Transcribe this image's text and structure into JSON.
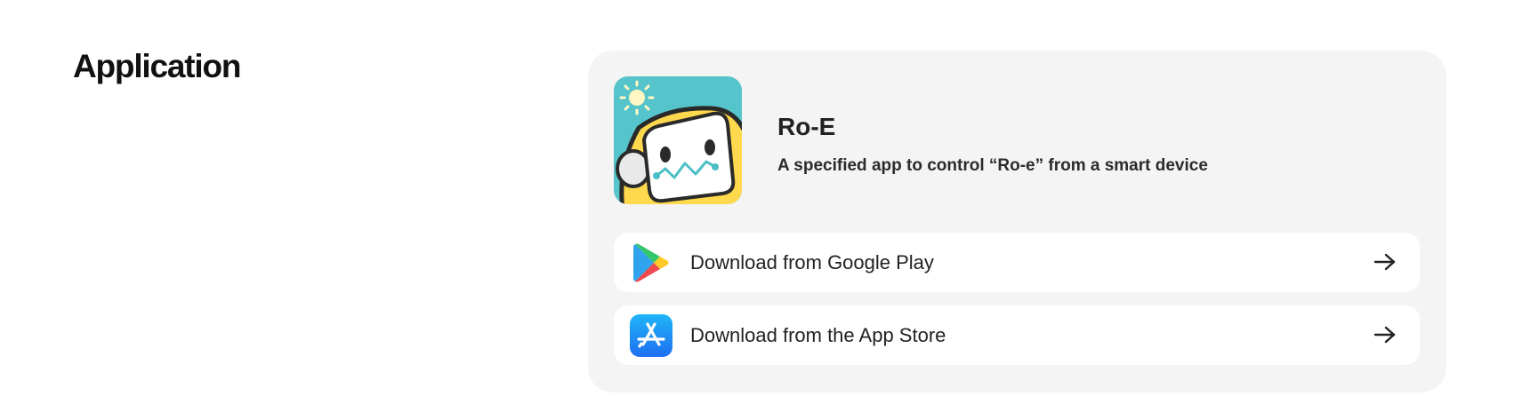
{
  "section": {
    "title": "Application"
  },
  "app": {
    "name": "Ro-E",
    "description": "A specified app to control “Ro-e” from a smart device",
    "icon": "ro-e-app-icon"
  },
  "downloads": [
    {
      "label": "Download from Google Play",
      "icon": "google-play-icon",
      "arrow": "arrow-right-icon"
    },
    {
      "label": "Download from the App Store",
      "icon": "app-store-icon",
      "arrow": "arrow-right-icon"
    }
  ],
  "colors": {
    "card_background": "#f4f4f4",
    "button_background": "#ffffff",
    "app_icon_teal": "#56c5cb",
    "app_icon_yellow": "#ffd94d",
    "app_store_blue": "#1e8bf5"
  }
}
